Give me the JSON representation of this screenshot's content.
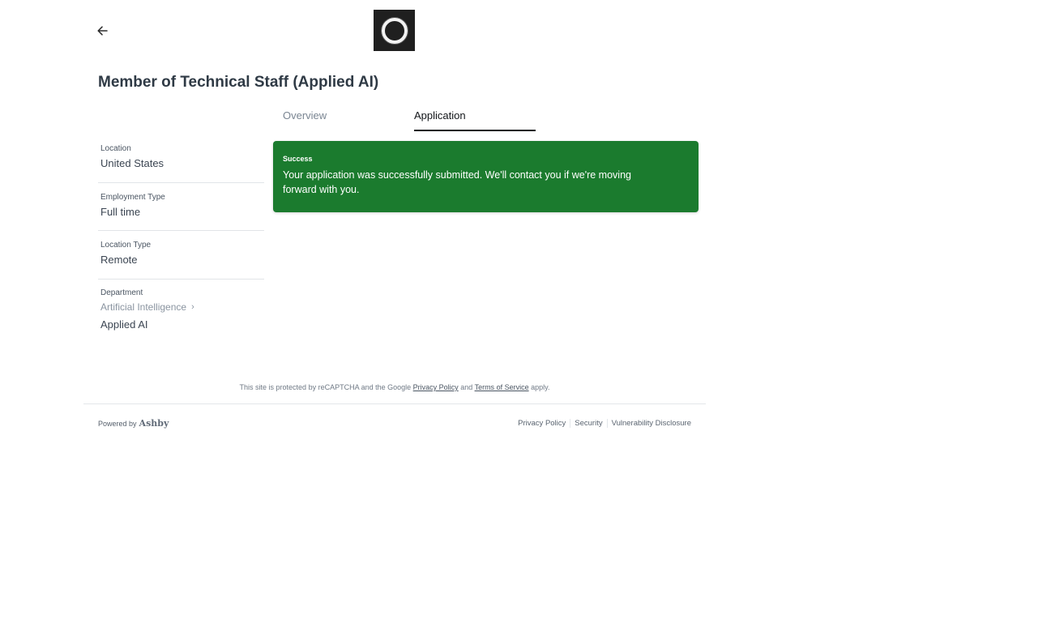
{
  "header": {
    "back_icon": "arrow-left-icon",
    "logo_icon": "ring-logo-icon"
  },
  "job": {
    "title": "Member of Technical Staff (Applied AI)"
  },
  "tabs": [
    {
      "label": "Overview",
      "active": false
    },
    {
      "label": "Application",
      "active": true
    }
  ],
  "sidebar": {
    "location": {
      "label": "Location",
      "value": "United States"
    },
    "employment_type": {
      "label": "Employment Type",
      "value": "Full time"
    },
    "location_type": {
      "label": "Location Type",
      "value": "Remote"
    },
    "department": {
      "label": "Department",
      "parent": "Artificial Intelligence",
      "value": "Applied AI"
    }
  },
  "success": {
    "title": "Success",
    "message": "Your application was successfully submitted. We'll contact you if we're moving forward with you.",
    "color": "#1b7b2e"
  },
  "recaptcha": {
    "prefix": "This site is protected by reCAPTCHA and the Google",
    "privacy_link": "Privacy Policy",
    "and": "and",
    "terms_link": "Terms of Service",
    "suffix": "apply."
  },
  "footer": {
    "powered_by": "Powered by",
    "brand": "Ashby",
    "links": [
      "Privacy Policy",
      "Security",
      "Vulnerability Disclosure"
    ]
  }
}
